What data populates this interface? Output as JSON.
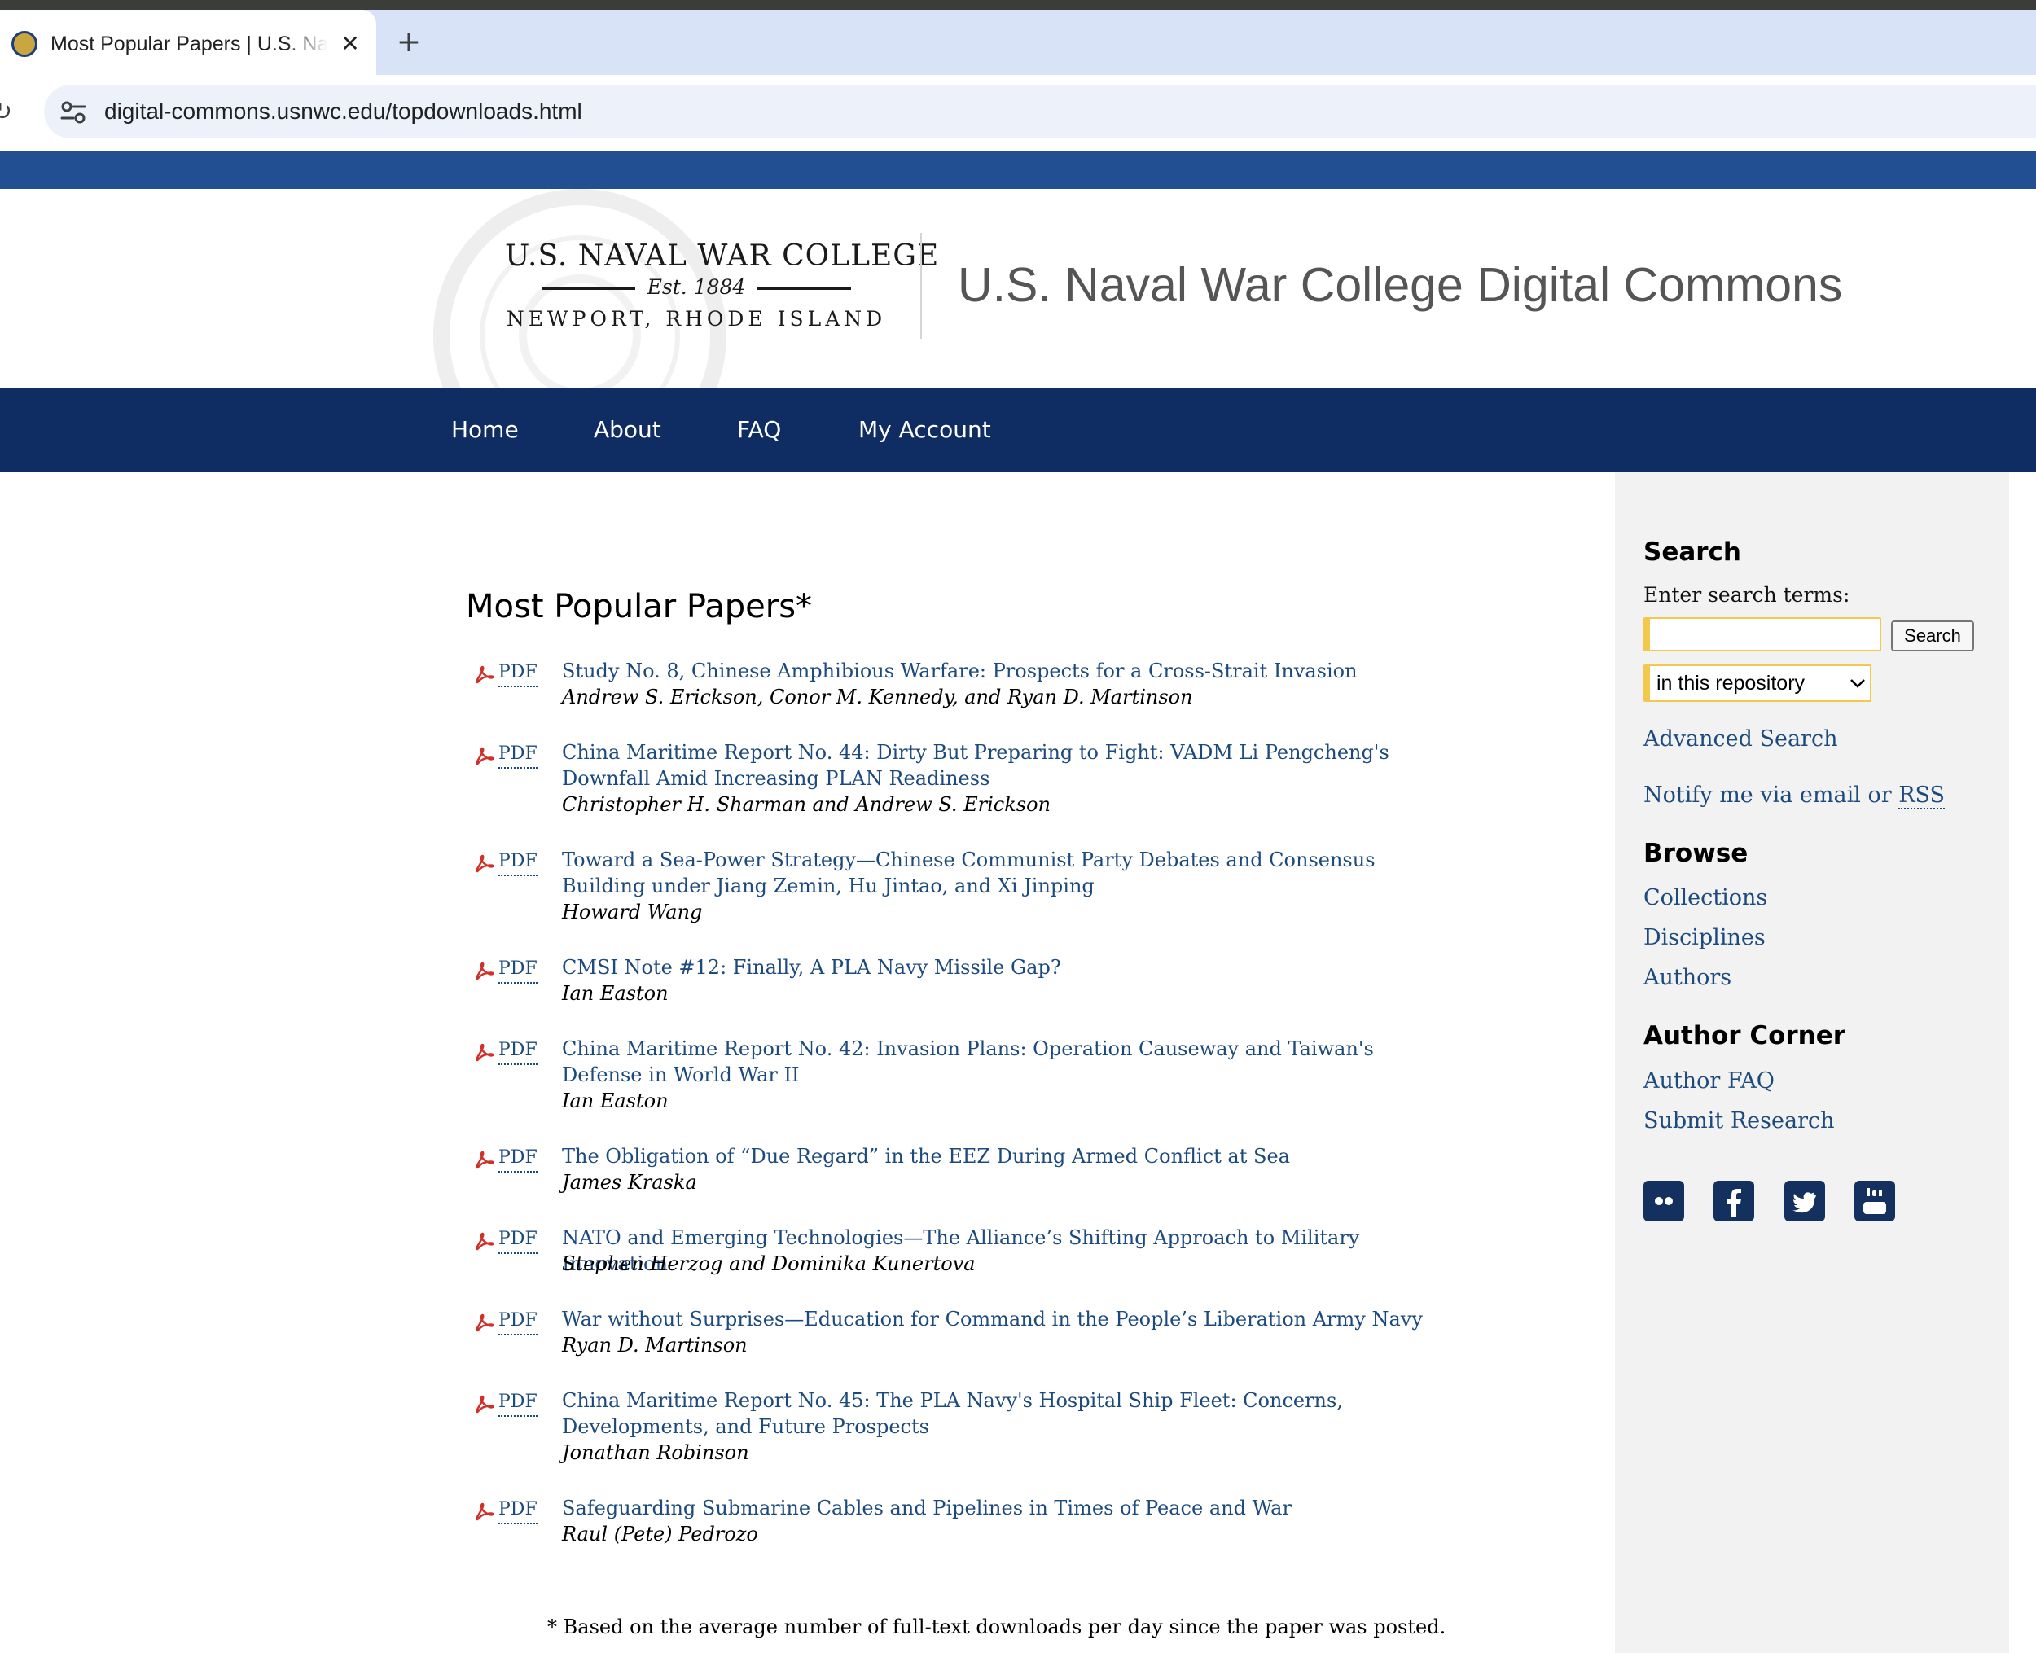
{
  "browser": {
    "tab_title": "Most Popular Papers | U.S. Naval War College Digital Commons",
    "close_glyph": "✕",
    "new_tab_glyph": "+",
    "reload_glyph": "↻",
    "url": "digital-commons.usnwc.edu/topdownloads.html"
  },
  "header": {
    "logo_line1": "U.S. NAVAL WAR COLLEGE",
    "logo_line2": "Est. 1884",
    "logo_line3": "NEWPORT, RHODE ISLAND",
    "site_title": "U.S. Naval War College Digital Commons"
  },
  "nav": [
    "Home",
    "About",
    "FAQ",
    "My Account"
  ],
  "main": {
    "title": "Most Popular Papers*",
    "pdf_label": "PDF",
    "papers": [
      {
        "title": "Study No. 8, Chinese Amphibious Warfare: Prospects for a Cross-Strait Invasion",
        "authors": "Andrew S. Erickson, Conor M. Kennedy, and Ryan D. Martinson"
      },
      {
        "title": "China Maritime Report No. 44: Dirty But Preparing to Fight: VADM Li Pengcheng's Downfall Amid Increasing PLAN Readiness",
        "authors": "Christopher H. Sharman and Andrew S. Erickson"
      },
      {
        "title": "Toward a Sea-Power Strategy—Chinese Communist Party Debates and Consensus Building under Jiang Zemin, Hu Jintao, and Xi Jinping",
        "authors": "Howard Wang"
      },
      {
        "title": "CMSI Note #12: Finally, A PLA Navy Missile Gap?",
        "authors": "Ian Easton"
      },
      {
        "title": "China Maritime Report No. 42: Invasion Plans: Operation Causeway and Taiwan's Defense in World War II",
        "authors": "Ian Easton"
      },
      {
        "title": "The Obligation of “Due Regard” in the EEZ During Armed Conflict at Sea",
        "authors": "James Kraska"
      },
      {
        "title": "NATO and Emerging Technologies—The Alliance’s Shifting Approach to Military Innovation",
        "authors": "Stephen Herzog and Dominika Kunertova"
      },
      {
        "title": "War without Surprises—Education for Command in the People’s Liberation Army Navy",
        "authors": "Ryan D. Martinson"
      },
      {
        "title": "China Maritime Report No. 45: The PLA Navy's Hospital Ship Fleet: Concerns, Developments, and Future Prospects",
        "authors": "Jonathan Robinson"
      },
      {
        "title": "Safeguarding Submarine Cables and Pipelines in Times of Peace and War",
        "authors": "Raul (Pete) Pedrozo"
      }
    ],
    "footnote": "* Based on the average number of full-text downloads per day since the paper was posted."
  },
  "sidebar": {
    "search_heading": "Search",
    "search_label": "Enter search terms:",
    "search_value": "",
    "search_button": "Search",
    "scope_selected": "in this repository",
    "advanced_search": "Advanced Search",
    "notify_text": "Notify me via email or ",
    "notify_rss": "RSS",
    "browse_heading": "Browse",
    "browse_links": [
      "Collections",
      "Disciplines",
      "Authors"
    ],
    "author_heading": "Author Corner",
    "author_links": [
      "Author FAQ",
      "Submit Research"
    ],
    "social": [
      "flickr-icon",
      "facebook-icon",
      "twitter-icon",
      "youtube-icon"
    ]
  },
  "colors": {
    "nav_bg": "#0f2d62",
    "strip_bg": "#224f91",
    "link": "#1d4a7d",
    "sidebar_bg": "#f2f2f2",
    "input_accent": "#f2c94c"
  }
}
